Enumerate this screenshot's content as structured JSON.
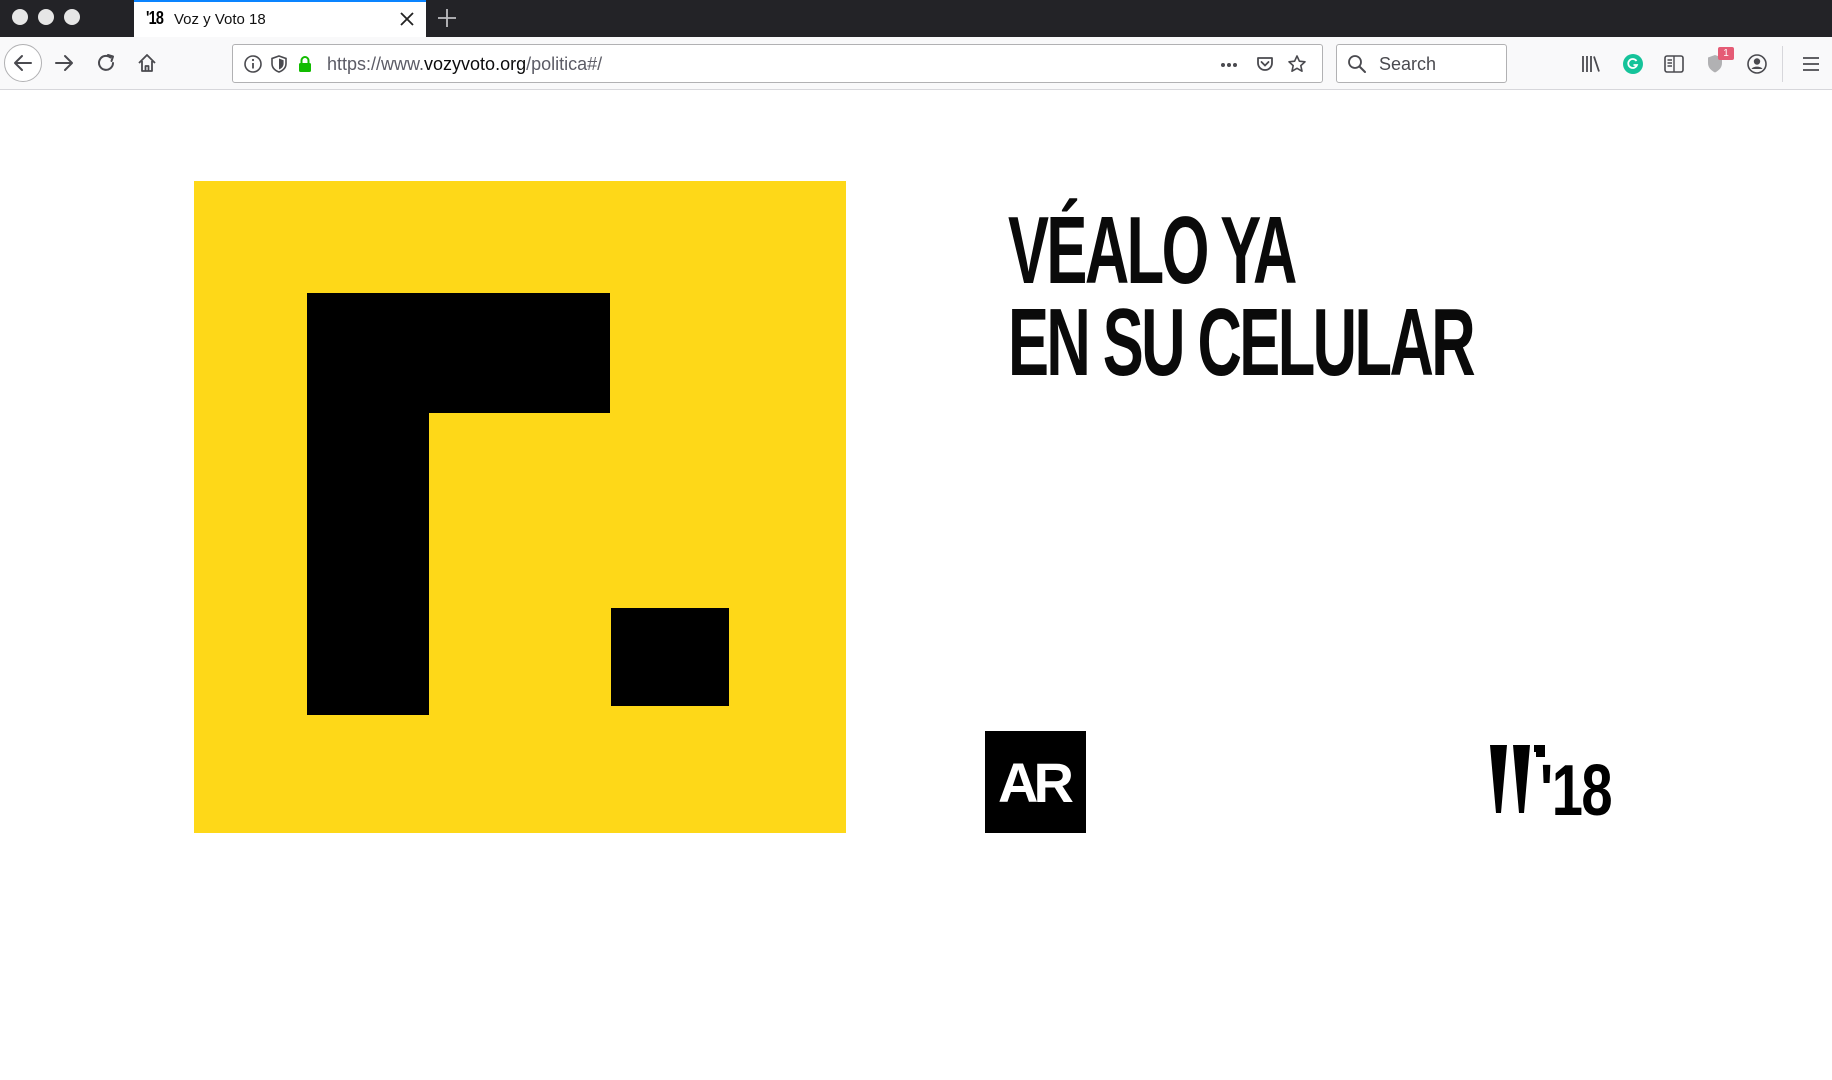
{
  "browser": {
    "tab": {
      "favicon_text": "'18",
      "title": "Voz y Voto 18"
    },
    "url": {
      "scheme": "https://www.",
      "host": "vozyvoto.org",
      "path": "/politica#/"
    },
    "search": {
      "placeholder": "Search"
    },
    "notification_badge": "1"
  },
  "page": {
    "heading_line1": "VÉALO YA",
    "heading_line2": "EN SU CELULAR",
    "ar_logo_text": "AR",
    "vv_logo_text": "'18"
  },
  "colors": {
    "promo_yellow": "#fed818",
    "ink": "#000000",
    "tab_accent": "#0a84ff",
    "badge": "#e55b75"
  }
}
